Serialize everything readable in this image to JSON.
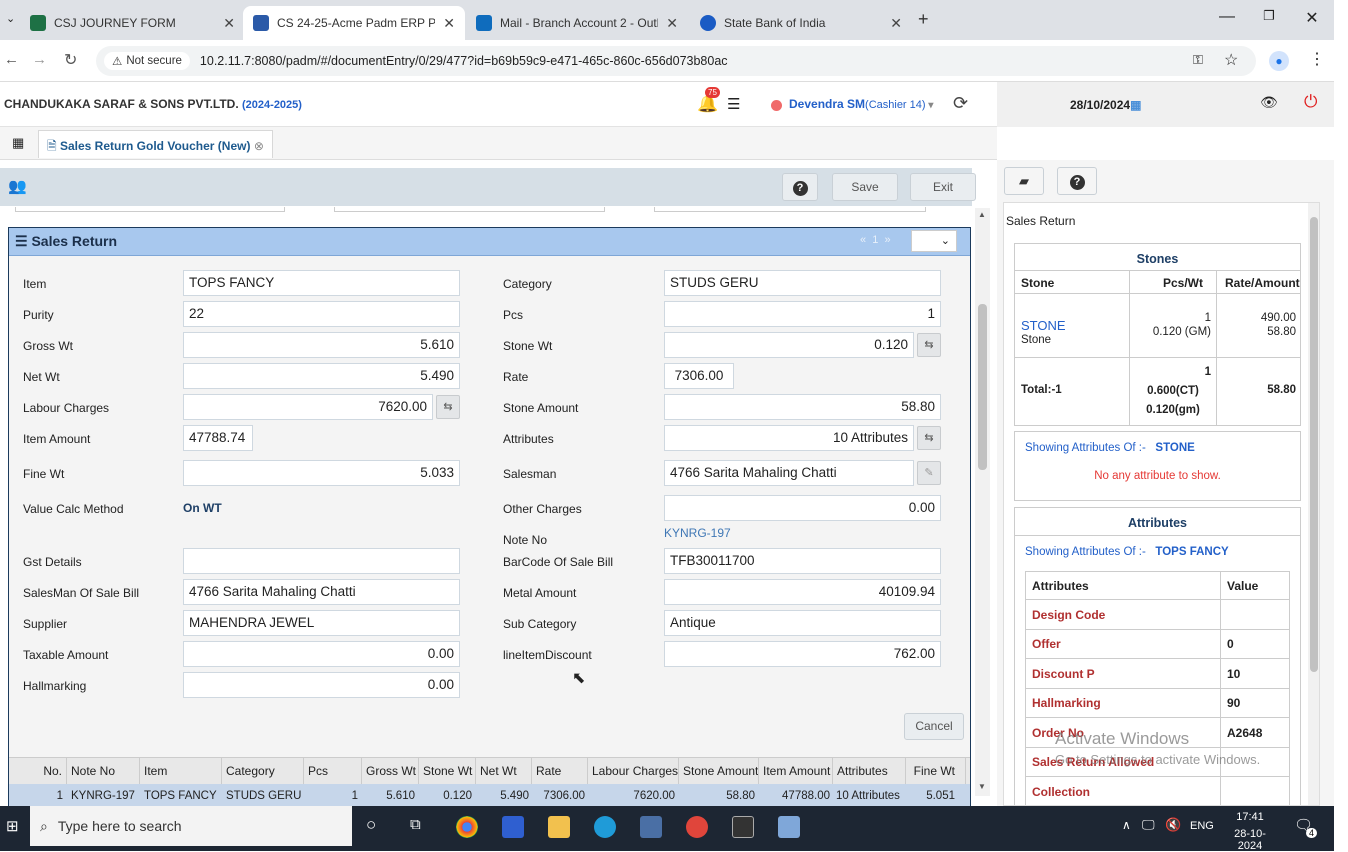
{
  "browser": {
    "tabs": [
      {
        "title": "CSJ JOURNEY FORM",
        "fav_color": "#1e7145"
      },
      {
        "title": "CS 24-25-Acme Padm ERP Platf",
        "fav_color": "#2b5aa8"
      },
      {
        "title": "Mail - Branch Account 2 - Outlo",
        "fav_color": "#0f6cbd"
      },
      {
        "title": "State Bank of India",
        "fav_color": "#1a5bc4"
      }
    ],
    "new_tab": "+",
    "not_secure": "Not secure",
    "url": "10.2.11.7:8080/padm/#/documentEntry/0/29/477?id=b69b59c9-e471-465c-860c-656d073b80ac"
  },
  "header": {
    "company": "CHANDUKAKA SARAF & SONS PVT.LTD.",
    "year": "(2024-2025)",
    "notif_count": "75",
    "user_name": "Devendra SM",
    "user_role": "(Cashier 14)",
    "date": "28/10/2024"
  },
  "doc_tab": {
    "label": "Sales Return Gold Voucher (New)"
  },
  "toolbar": {
    "save": "Save",
    "exit": "Exit"
  },
  "panel": {
    "title": "Sales Return",
    "page": "1",
    "nav_prev": "«",
    "nav_next": "»"
  },
  "form_left": [
    {
      "label": "Item",
      "value": "TOPS FANCY"
    },
    {
      "label": "Purity",
      "value": "22"
    },
    {
      "label": "Gross Wt",
      "value": "5.610"
    },
    {
      "label": "Net Wt",
      "value": "5.490"
    },
    {
      "label": "Labour Charges",
      "value": "7620.00"
    },
    {
      "label": "Item Amount",
      "value": "47788.74"
    },
    {
      "label": "Fine Wt",
      "value": "5.033"
    },
    {
      "label": "Value Calc Method",
      "value": "On WT"
    },
    {
      "label": "Gst Details",
      "value": ""
    },
    {
      "label": "SalesMan Of Sale Bill",
      "value": "4766 Sarita Mahaling Chatti"
    },
    {
      "label": "Supplier",
      "value": "MAHENDRA JEWEL"
    },
    {
      "label": "Taxable Amount",
      "value": "0.00"
    },
    {
      "label": "Hallmarking",
      "value": "0.00"
    }
  ],
  "form_right": [
    {
      "label": "Category",
      "value": "STUDS GERU"
    },
    {
      "label": "Pcs",
      "value": "1"
    },
    {
      "label": "Stone Wt",
      "value": "0.120"
    },
    {
      "label": "Rate",
      "value": "7306.00"
    },
    {
      "label": "Stone Amount",
      "value": "58.80"
    },
    {
      "label": "Attributes",
      "value": "10 Attributes"
    },
    {
      "label": "Salesman",
      "value": "4766 Sarita Mahaling Chatti"
    },
    {
      "label": "Other Charges",
      "value": "0.00"
    },
    {
      "label": "Note No",
      "value": "KYNRG-197"
    },
    {
      "label": "BarCode Of Sale Bill",
      "value": "TFB30011700"
    },
    {
      "label": "Metal Amount",
      "value": "40109.94"
    },
    {
      "label": "Sub Category",
      "value": "Antique"
    },
    {
      "label": "lineItemDiscount",
      "value": "762.00"
    }
  ],
  "cancel": "Cancel",
  "grid": {
    "headers": [
      "No.",
      "Note No",
      "Item",
      "Category",
      "Pcs",
      "Gross Wt",
      "Stone Wt",
      "Net Wt",
      "Rate",
      "Labour Charges",
      "Stone Amount",
      "Item Amount",
      "Attributes",
      "Fine Wt"
    ],
    "row": [
      "1",
      "KYNRG-197",
      "TOPS FANCY",
      "STUDS GERU",
      "1",
      "5.610",
      "0.120",
      "5.490",
      "7306.00",
      "7620.00",
      "58.80",
      "47788.00",
      "10 Attributes",
      "5.051"
    ]
  },
  "side": {
    "heading": "Sales Return",
    "stones_title": "Stones",
    "stones_cols": [
      "Stone",
      "Pcs/Wt",
      "Rate/Amount"
    ],
    "stone_name": "STONE",
    "stone_sub": "Stone",
    "stone_pcs": "1",
    "stone_wt": "0.120 (GM)",
    "stone_rate": "490.00",
    "stone_amt": "58.80",
    "total_label": "Total:-1",
    "total_pcs": "1",
    "total_ct": "0.600(CT)",
    "total_gm": "0.120(gm)",
    "total_amt": "58.80",
    "showing_prefix": "Showing Attributes Of :-",
    "showing_stone": "STONE",
    "no_attr": "No any attribute to show.",
    "attr_title": "Attributes",
    "showing_item": "TOPS FANCY",
    "attr_cols": [
      "Attributes",
      "Value"
    ],
    "attrs": [
      {
        "name": "Design Code",
        "value": ""
      },
      {
        "name": "Offer",
        "value": "0"
      },
      {
        "name": "Discount P",
        "value": "10"
      },
      {
        "name": "Hallmarking",
        "value": "90"
      },
      {
        "name": "Order No",
        "value": "A2648"
      },
      {
        "name": "Sales Return Allowed",
        "value": ""
      },
      {
        "name": "Collection",
        "value": ""
      }
    ]
  },
  "watermark": {
    "line1": "Activate Windows",
    "line2": "Go to Settings to activate Windows."
  },
  "taskbar": {
    "search": "Type here to search",
    "lang": "ENG",
    "time": "17:41",
    "date": "28-10-2024",
    "notif": "4"
  }
}
